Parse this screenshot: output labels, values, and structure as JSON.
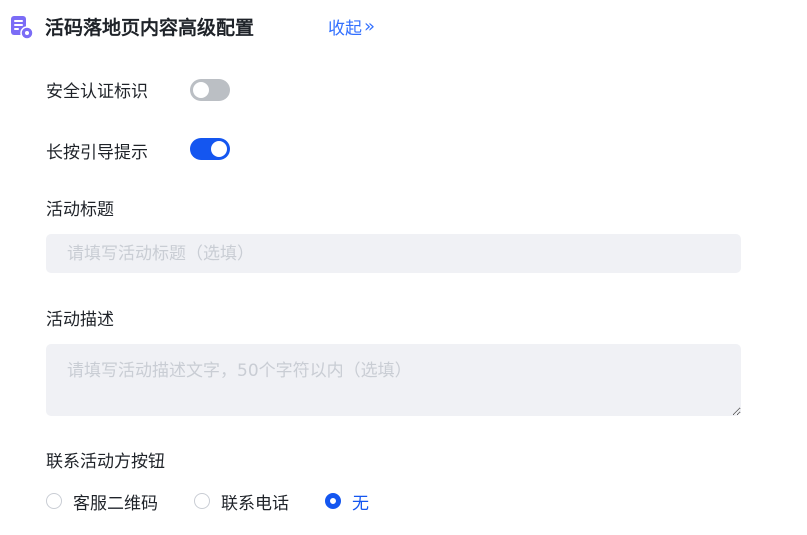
{
  "header": {
    "icon": "form-settings-icon",
    "title": "活码落地页内容高级配置",
    "collapse_label": "收起",
    "collapse_icon": "double-chevron-right-icon"
  },
  "security_badge": {
    "label": "安全认证标识",
    "enabled": false
  },
  "long_press_hint": {
    "label": "长按引导提示",
    "enabled": true
  },
  "activity_title": {
    "label": "活动标题",
    "value": "",
    "placeholder": "请填写活动标题（选填）"
  },
  "activity_description": {
    "label": "活动描述",
    "value": "",
    "placeholder": "请填写活动描述文字，50个字符以内（选填）"
  },
  "contact_button": {
    "label": "联系活动方按钮",
    "options": [
      {
        "label": "客服二维码",
        "selected": false
      },
      {
        "label": "联系电话",
        "selected": false
      },
      {
        "label": "无",
        "selected": true
      }
    ]
  },
  "colors": {
    "accent": "#1456f0",
    "link": "#3370ff",
    "switch_off": "#bbbfc4",
    "input_bg": "#f0f1f5",
    "icon": "#7b6cf6"
  }
}
